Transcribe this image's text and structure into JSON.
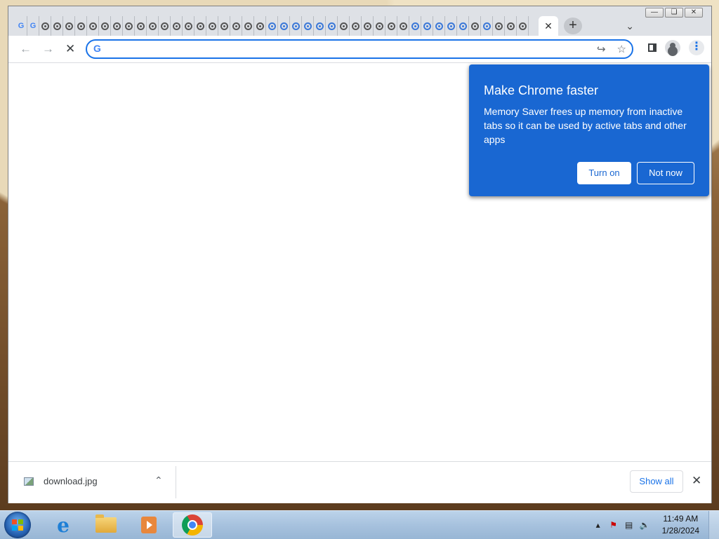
{
  "window": {
    "controls": {
      "minimize": "—",
      "restore": "❏",
      "close": "✕"
    }
  },
  "tabs": {
    "favicons": [
      "g",
      "g",
      "c",
      "c",
      "c",
      "c",
      "c",
      "c",
      "c",
      "c",
      "c",
      "c",
      "c",
      "c",
      "c",
      "c",
      "c",
      "c",
      "c",
      "c",
      "c",
      "b",
      "b",
      "b",
      "b",
      "b",
      "b",
      "c",
      "c",
      "c",
      "c",
      "c",
      "c",
      "b",
      "b",
      "b",
      "b",
      "b",
      "c",
      "b",
      "c",
      "c",
      "c"
    ],
    "active_tab_close": "✕",
    "new_tab": "+",
    "tab_search": "⌄"
  },
  "toolbar": {
    "back": "←",
    "forward": "→",
    "stop": "✕",
    "omnibox_icon": "G",
    "omnibox_value": "",
    "omnibox_placeholder": "",
    "share": "↪",
    "bookmark": "☆",
    "menu": "⋮"
  },
  "popup": {
    "title": "Make Chrome faster",
    "body": "Memory Saver frees up memory from inactive tabs so it can be used by active tabs and other apps",
    "turn_on": "Turn on",
    "not_now": "Not now"
  },
  "downloads": {
    "file_name": "download.jpg",
    "chevron": "⌃",
    "show_all": "Show all",
    "close": "✕"
  },
  "taskbar": {
    "apps": [
      "internet-explorer",
      "file-explorer",
      "media-player",
      "chrome"
    ],
    "tray_up": "▴",
    "time": "11:49 AM",
    "date": "1/28/2024"
  },
  "colors": {
    "accent": "#1a73e8",
    "popup_bg": "#1967d2",
    "tabstrip_bg": "#dee1e6"
  }
}
